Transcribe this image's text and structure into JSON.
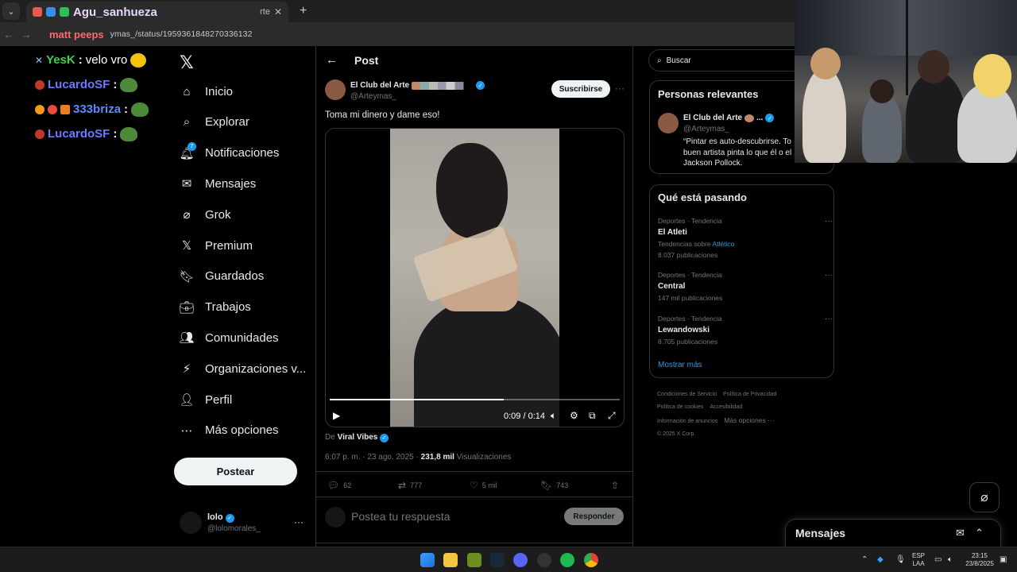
{
  "browser": {
    "tab_title": "Agu_sanhueza",
    "tab_suffix": "rte",
    "url": "ymas_/status/1959361848270336132",
    "chat_overlay_user": "matt peeps"
  },
  "chat": [
    {
      "user": "YesK",
      "message": "velo vro",
      "color": "#3ad24a"
    },
    {
      "user": "LucardoSF",
      "message": "",
      "color": "#5b6bff"
    },
    {
      "user": "333briza",
      "message": "",
      "color": "#4e7bff"
    },
    {
      "user": "LucardoSF",
      "message": "",
      "color": "#5b6bff"
    }
  ],
  "nav": {
    "items": [
      {
        "label": "Inicio",
        "icon": "home-icon"
      },
      {
        "label": "Explorar",
        "icon": "search-icon"
      },
      {
        "label": "Notificaciones",
        "icon": "bell-icon",
        "badge": "7"
      },
      {
        "label": "Mensajes",
        "icon": "mail-icon"
      },
      {
        "label": "Grok",
        "icon": "grok-icon"
      },
      {
        "label": "Premium",
        "icon": "x-icon"
      },
      {
        "label": "Guardados",
        "icon": "bookmark-icon"
      },
      {
        "label": "Trabajos",
        "icon": "briefcase-icon"
      },
      {
        "label": "Comunidades",
        "icon": "communities-icon"
      },
      {
        "label": "Organizaciones v...",
        "icon": "lightning-icon"
      },
      {
        "label": "Perfil",
        "icon": "person-icon"
      },
      {
        "label": "Más opciones",
        "icon": "more-icon"
      }
    ],
    "post_button": "Postear",
    "account_name": "lolo",
    "account_handle": "@lolomorales_"
  },
  "post": {
    "header": "Post",
    "author_name": "El Club del Arte",
    "author_handle": "@Arteymas_",
    "subscribe": "Suscribirse",
    "text": "Toma mi dinero y dame eso!",
    "video_time": "0:09 / 0:14",
    "video_progress": 0.6,
    "via_prefix": "De",
    "via_name": "Viral Vibes",
    "timestamp": "6:07 p. m. · 23 ago. 2025 · ",
    "views_count": "231,8 mil",
    "views_label": " Visualizaciones",
    "replies": "62",
    "reposts": "777",
    "likes": "5 mil",
    "bookmarks": "743",
    "reply_placeholder": "Postea tu respuesta",
    "reply_button": "Responder"
  },
  "right": {
    "search_placeholder": "Buscar",
    "relevant_title": "Personas relevantes",
    "relevant_name": "El Club del Arte",
    "relevant_handle": "@Arteymas_",
    "relevant_bio": "“Pintar es auto-descubrirse. To buen artista pinta lo que él o el Jackson Pollock.",
    "trending_title": "Qué está pasando",
    "trends": [
      {
        "category": "Deportes · Tendencia",
        "name": "El Atleti",
        "sub_prefix": "Tendencias sobre ",
        "sub_link": "Atlético",
        "posts": "8.037 publicaciones"
      },
      {
        "category": "Deportes · Tendencia",
        "name": "Central",
        "posts": "147 mil publicaciones"
      },
      {
        "category": "Deportes · Tendencia",
        "name": "Lewandowski",
        "posts": "8.705 publicaciones"
      }
    ],
    "show_more": "Mostrar más",
    "footer": [
      "Condiciones de Servicio",
      "Política de Privacidad",
      "Política de cookies",
      "Accesibilidad",
      "Información de anuncios",
      "Más opciones ···",
      "© 2025 X Corp."
    ]
  },
  "messages_drawer": {
    "title": "Mensajes"
  },
  "taskbar": {
    "lang_top": "ESP",
    "lang_bottom": "LAA",
    "time": "23:15",
    "date": "23/8/2025"
  },
  "colors": {
    "accent": "#1d9bf0",
    "background": "#000000",
    "border": "#2f3336",
    "muted": "#71767b"
  }
}
